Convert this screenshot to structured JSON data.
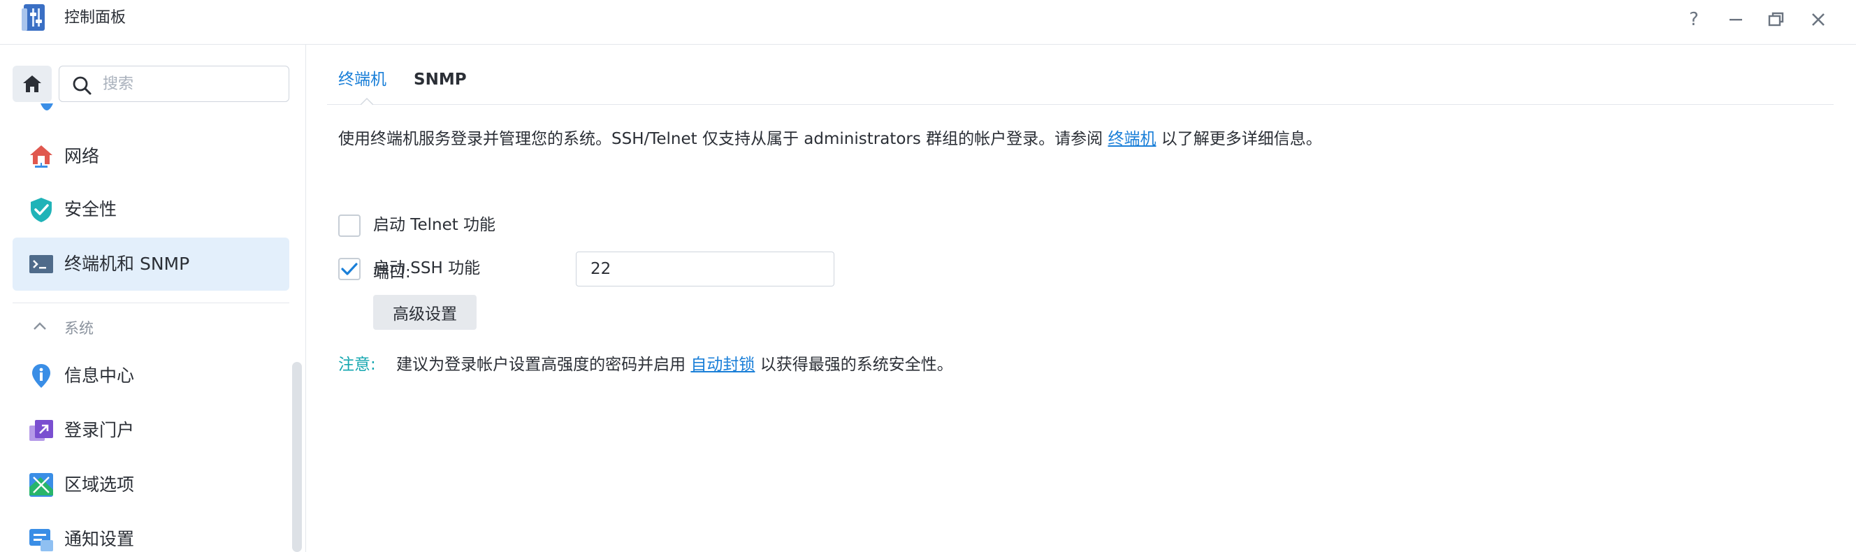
{
  "window": {
    "title": "控制面板",
    "controls": {
      "help": "?",
      "minimize": "—",
      "restore": "❐",
      "close": "✕"
    }
  },
  "sidebar": {
    "search_placeholder": "搜索",
    "items": [
      {
        "label": "网络",
        "icon": "network-icon"
      },
      {
        "label": "安全性",
        "icon": "security-shield-icon"
      },
      {
        "label": "终端机和 SNMP",
        "icon": "terminal-icon",
        "active": true
      }
    ],
    "section": {
      "label": "系统",
      "items": [
        {
          "label": "信息中心",
          "icon": "info-center-icon"
        },
        {
          "label": "登录门户",
          "icon": "login-portal-icon"
        },
        {
          "label": "区域选项",
          "icon": "regional-options-icon"
        },
        {
          "label": "通知设置",
          "icon": "notification-icon"
        }
      ]
    }
  },
  "tabs": [
    {
      "label": "终端机",
      "active": true
    },
    {
      "label": "SNMP",
      "active": false
    }
  ],
  "terminal": {
    "description_prefix": "使用终端机服务登录并管理您的系统。SSH/Telnet 仅支持从属于 administrators 群组的帐户登录。请参阅",
    "description_link": "终端机",
    "description_suffix": "以了解更多详细信息。",
    "telnet": {
      "label": "启动 Telnet 功能",
      "checked": false
    },
    "ssh": {
      "label": "启动 SSH 功能",
      "checked": true
    },
    "port_label": "端口:",
    "port_value": "22",
    "advanced_button": "高级设置",
    "note_tag": "注意:",
    "note_prefix": "建议为登录帐户设置高强度的密码并启用",
    "note_link": "自动封锁",
    "note_suffix": "以获得最强的系统安全性。"
  },
  "colors": {
    "accent": "#1a7fd8",
    "note": "#15a7b0",
    "active_item_bg": "#e3effb"
  }
}
